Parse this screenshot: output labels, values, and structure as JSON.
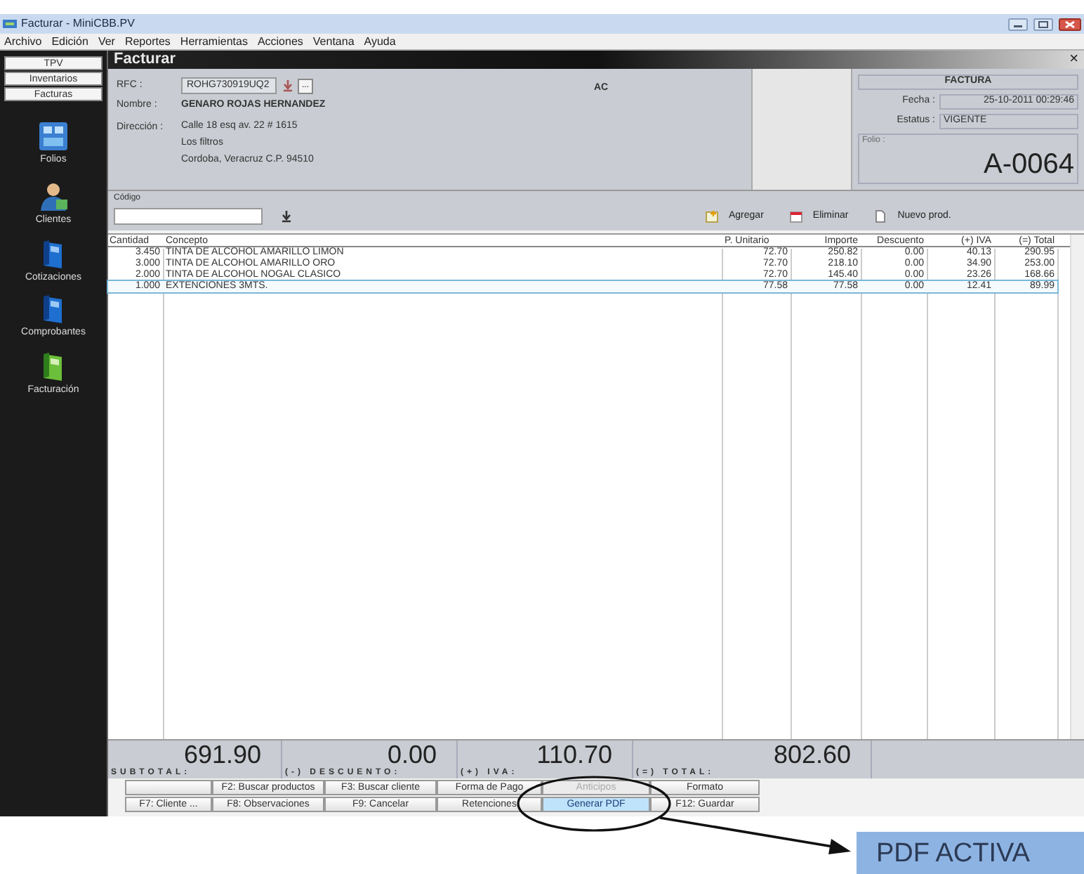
{
  "window": {
    "title": "Facturar - MiniCBB.PV"
  },
  "menu": [
    "Archivo",
    "Edición",
    "Ver",
    "Reportes",
    "Herramientas",
    "Acciones",
    "Ventana",
    "Ayuda"
  ],
  "sidebar": {
    "tabs": [
      "TPV",
      "Inventarios",
      "Facturas"
    ],
    "items": [
      {
        "label": "Folios",
        "kind": "grid"
      },
      {
        "label": "Clientes",
        "kind": "person"
      },
      {
        "label": "Cotizaciones",
        "kind": "book"
      },
      {
        "label": "Comprobantes",
        "kind": "book"
      },
      {
        "label": "Facturación",
        "kind": "ledger"
      }
    ]
  },
  "panel": {
    "title": "Facturar",
    "close": "×"
  },
  "customer": {
    "rfc_label": "RFC :",
    "rfc": "ROHG730919UQ2",
    "more": "...",
    "nombre_label": "Nombre :",
    "nombre": "GENARO ROJAS HERNANDEZ",
    "direccion_label": "Dirección :",
    "direccion": [
      "Calle 18 esq av. 22 # 1615",
      "Los filtros",
      "Cordoba, Veracruz C.P. 94510"
    ],
    "company": "AC"
  },
  "invoice": {
    "type": "FACTURA",
    "fecha_label": "Fecha :",
    "fecha": "25-10-2011 00:29:46",
    "estatus_label": "Estatus :",
    "estatus": "VIGENTE",
    "folio_label": "Folio :",
    "folio": "A-0064"
  },
  "code_field": {
    "label": "Código"
  },
  "toolbar": [
    {
      "label": "Agregar",
      "kind": "add"
    },
    {
      "label": "Eliminar",
      "kind": "delete"
    },
    {
      "label": "Nuevo prod.",
      "kind": "new"
    }
  ],
  "table": {
    "columns": [
      "Cantidad",
      "Concepto",
      "P. Unitario",
      "Importe",
      "Descuento",
      "(+) IVA",
      "(=) Total"
    ],
    "rows": [
      {
        "cells": [
          "3.450",
          "TINTA DE ALCOHOL AMARILLO LIMON",
          "72.70",
          "250.82",
          "0.00",
          "40.13",
          "290.95"
        ],
        "selected": false
      },
      {
        "cells": [
          "3.000",
          "TINTA DE ALCOHOL AMARILLO ORO",
          "72.70",
          "218.10",
          "0.00",
          "34.90",
          "253.00"
        ],
        "selected": false
      },
      {
        "cells": [
          "2.000",
          "TINTA DE ALCOHOL NOGAL CLASICO",
          "72.70",
          "145.40",
          "0.00",
          "23.26",
          "168.66"
        ],
        "selected": false
      },
      {
        "cells": [
          "1.000",
          "EXTENCIONES 3MTS.",
          "77.58",
          "77.58",
          "0.00",
          "12.41",
          "89.99"
        ],
        "selected": true
      }
    ]
  },
  "totals": [
    {
      "label": "SUBTOTAL:",
      "value": "691.90"
    },
    {
      "label": "(-) DESCUENTO:",
      "value": "0.00"
    },
    {
      "label": "(+) IVA:",
      "value": "110.70"
    },
    {
      "label": "(=) TOTAL:",
      "value": "802.60"
    }
  ],
  "buttons": [
    [
      {
        "disabled": false,
        "focused": false
      },
      {
        "label": "F2: Buscar productos",
        "disabled": false,
        "focused": false
      },
      {
        "label": "F3: Buscar cliente",
        "disabled": false,
        "focused": false
      },
      {
        "label": "Forma de Pago",
        "disabled": false,
        "focused": false
      },
      {
        "label": "Anticipos",
        "disabled": true,
        "focused": false
      },
      {
        "label": "Formato",
        "disabled": false,
        "focused": false
      }
    ],
    [
      {
        "label": "F7: Cliente ...",
        "disabled": false,
        "focused": false
      },
      {
        "label": "F8: Observaciones",
        "disabled": false,
        "focused": false
      },
      {
        "label": "F9: Cancelar",
        "disabled": false,
        "focused": false
      },
      {
        "label": "Retenciones",
        "disabled": false,
        "focused": false
      },
      {
        "label": "Generar PDF",
        "disabled": false,
        "focused": true
      },
      {
        "label": "F12: Guardar",
        "disabled": false,
        "focused": false
      }
    ]
  ],
  "annotation": {
    "text": "PDF ACTIVA"
  }
}
